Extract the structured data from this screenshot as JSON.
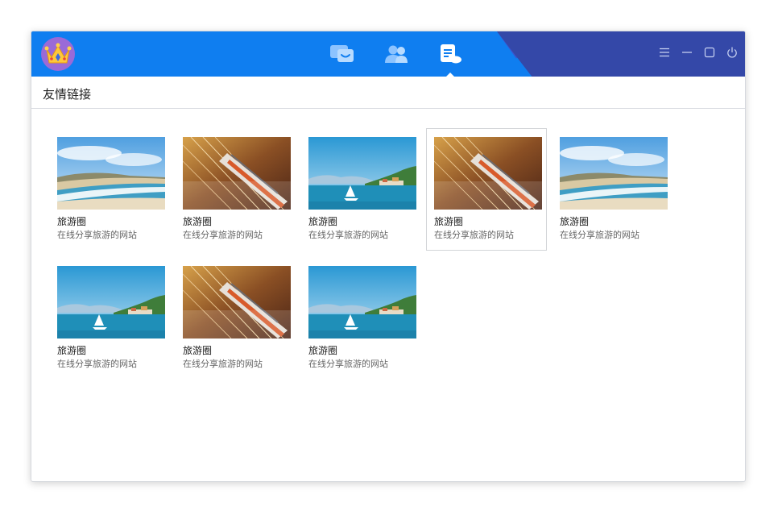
{
  "header": {
    "nav": [
      {
        "icon": "chat-icon",
        "active": false
      },
      {
        "icon": "contacts-icon",
        "active": false
      },
      {
        "icon": "document-icon",
        "active": true
      }
    ],
    "controls": [
      "menu-icon",
      "minimize-icon",
      "maximize-icon",
      "power-icon"
    ]
  },
  "section": {
    "title": "友情链接"
  },
  "links": [
    {
      "title": "旅游圈",
      "desc": "在线分享旅游的网站",
      "thumb": "beach"
    },
    {
      "title": "旅游圈",
      "desc": "在线分享旅游的网站",
      "thumb": "train"
    },
    {
      "title": "旅游圈",
      "desc": "在线分享旅游的网站",
      "thumb": "lake"
    },
    {
      "title": "旅游圈",
      "desc": "在线分享旅游的网站",
      "thumb": "train",
      "selected": true
    },
    {
      "title": "旅游圈",
      "desc": "在线分享旅游的网站",
      "thumb": "beach"
    },
    {
      "title": "旅游圈",
      "desc": "在线分享旅游的网站",
      "thumb": "lake"
    },
    {
      "title": "旅游圈",
      "desc": "在线分享旅游的网站",
      "thumb": "train"
    },
    {
      "title": "旅游圈",
      "desc": "在线分享旅游的网站",
      "thumb": "lake"
    }
  ],
  "colors": {
    "titlebar": "#0f7ef0",
    "titlebar_dark": "#3448a8",
    "avatar_bg": "#9a6ad8"
  }
}
